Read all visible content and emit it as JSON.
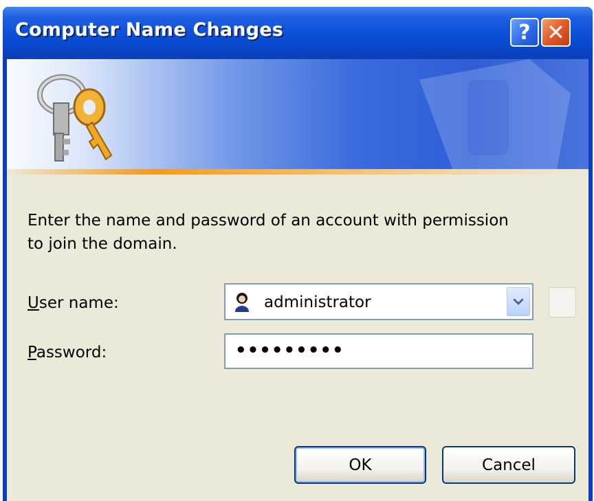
{
  "window": {
    "title": "Computer Name Changes",
    "help_label": "?",
    "close_label": "✕"
  },
  "content": {
    "instruction": "Enter the name and password of an account with permission\nto join the domain.",
    "username_label_accel": "U",
    "username_label_rest": "ser name:",
    "username_value": "administrator",
    "password_label_accel": "P",
    "password_label_rest": "assword:",
    "password_value": "•••••••••"
  },
  "buttons": {
    "ok": "OK",
    "cancel": "Cancel"
  },
  "colors": {
    "titlebar": "#0a4fd8",
    "client_bg": "#ece9d8",
    "close_button": "#e25a28",
    "field_border": "#7f9db9"
  },
  "icons": [
    "keys-icon",
    "user-icon",
    "chevron-down-icon",
    "help-icon",
    "close-icon"
  ]
}
